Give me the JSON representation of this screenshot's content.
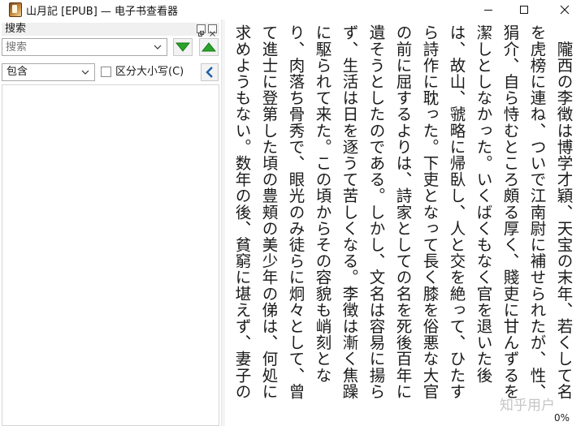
{
  "window": {
    "title": "山月記 [EPUB] — 电子书查看器"
  },
  "search_panel": {
    "title": "搜索",
    "search_placeholder": "搜索",
    "search_value": "",
    "mode_selected": "包含",
    "case_checkbox_label": "区分大小写(C)",
    "case_checked": false
  },
  "reader": {
    "text": "　隴西の李徴は博学才穎、天宝の末年、若くして名を虎榜に連ね、ついで江南尉に補せられたが、性、狷介、自ら恃むところ頗る厚く、賤吏に甘んずるを潔しとしなかった。いくばくもなく官を退いた後は、故山、虢略に帰臥し、人と交を絶って、ひたすら詩作に耽った。下吏となって長く膝を俗悪な大官の前に屈するよりは、詩家としての名を死後百年に遺そうとしたのである。しかし、文名は容易に揚らず、生活は日を逐うて苦しくなる。李徴は漸く焦躁に駆られて来た。この頃からその容貌も峭刻となり、肉落ち骨秀で、眼光のみ徒らに炯々として、曾て進士に登第した頃の豊頬の美少年の俤は、何処に求めようもない。数年の後、貧窮に堪えず、妻子の衣食のために遂に節を屈して、再び東へ赴き、一地方官吏の職を奉ずることになった。一方、これは、己の詩業に",
    "progress": "0%",
    "watermark": "知乎用户"
  }
}
